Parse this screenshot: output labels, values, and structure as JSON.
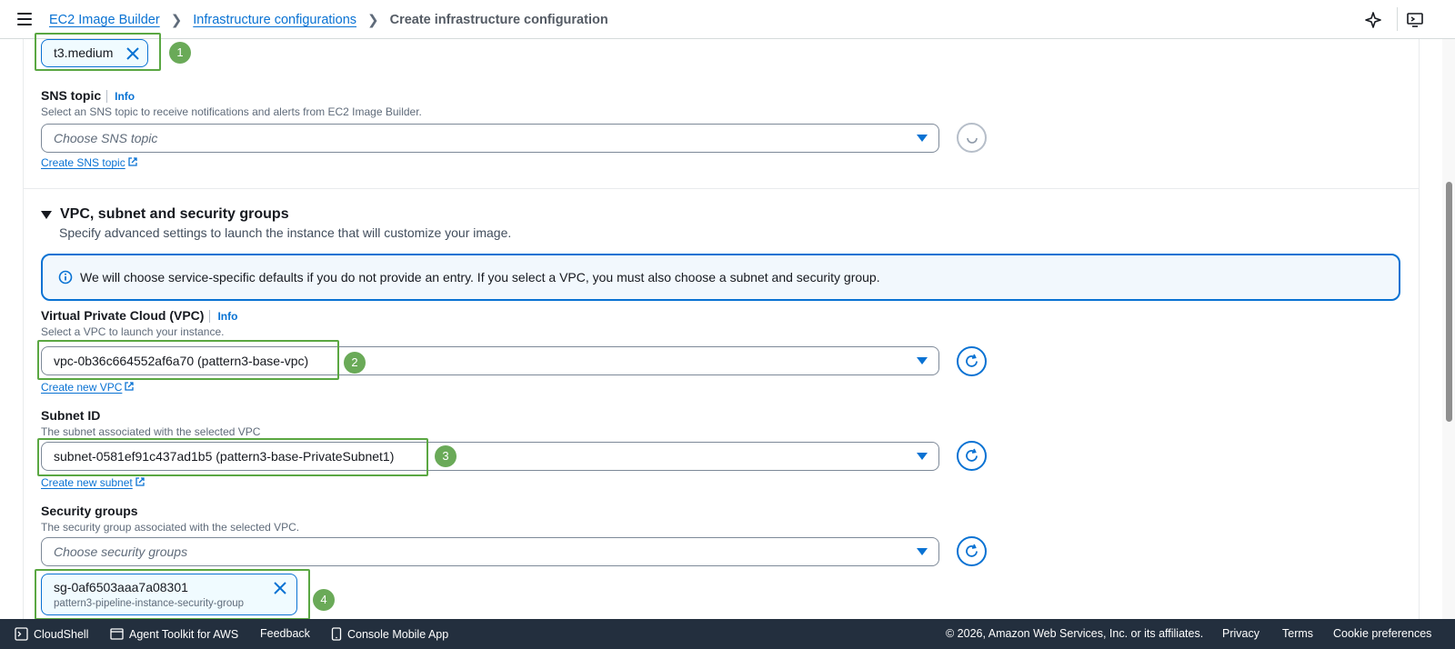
{
  "header": {
    "breadcrumb": [
      "EC2 Image Builder",
      "Infrastructure configurations",
      "Create infrastructure configuration"
    ],
    "icons": [
      "menu-icon",
      "sparkle-icon",
      "display-settings-icon"
    ]
  },
  "instance_type_token": {
    "label": "t3.medium",
    "annotation": "1"
  },
  "sns": {
    "label": "SNS topic",
    "info": "Info",
    "description": "Select an SNS topic to receive notifications and alerts from EC2 Image Builder.",
    "placeholder": "Choose SNS topic",
    "create_link": "Create SNS topic"
  },
  "vpc_section": {
    "title": "VPC, subnet and security groups",
    "description": "Specify advanced settings to launch the instance that will customize your image.",
    "alert": "We will choose service-specific defaults if you do not provide an entry. If you select a VPC, you must also choose a subnet and security group."
  },
  "vpc": {
    "label": "Virtual Private Cloud (VPC)",
    "info": "Info",
    "description": "Select a VPC to launch your instance.",
    "value": "vpc-0b36c664552af6a70 (pattern3-base-vpc)",
    "annotation": "2",
    "create_link": "Create new VPC"
  },
  "subnet": {
    "label": "Subnet ID",
    "description": "The subnet associated with the selected VPC",
    "value": "subnet-0581ef91c437ad1b5 (pattern3-base-PrivateSubnet1)",
    "annotation": "3",
    "create_link": "Create new subnet"
  },
  "security_groups": {
    "label": "Security groups",
    "description": "The security group associated with the selected VPC.",
    "placeholder": "Choose security groups",
    "token_id": "sg-0af6503aaa7a08301",
    "token_name": "pattern3-pipeline-instance-security-group",
    "annotation": "4"
  },
  "footer": {
    "cloudshell": "CloudShell",
    "agent_toolkit": "Agent Toolkit for AWS",
    "feedback": "Feedback",
    "console_mobile": "Console Mobile App",
    "copyright": "© 2026, Amazon Web Services, Inc. or its affiliates.",
    "privacy": "Privacy",
    "terms": "Terms",
    "cookie": "Cookie preferences"
  },
  "colors": {
    "link": "#0972d3",
    "annotation_green": "#5aa742",
    "footer_bg": "#232f3e"
  }
}
